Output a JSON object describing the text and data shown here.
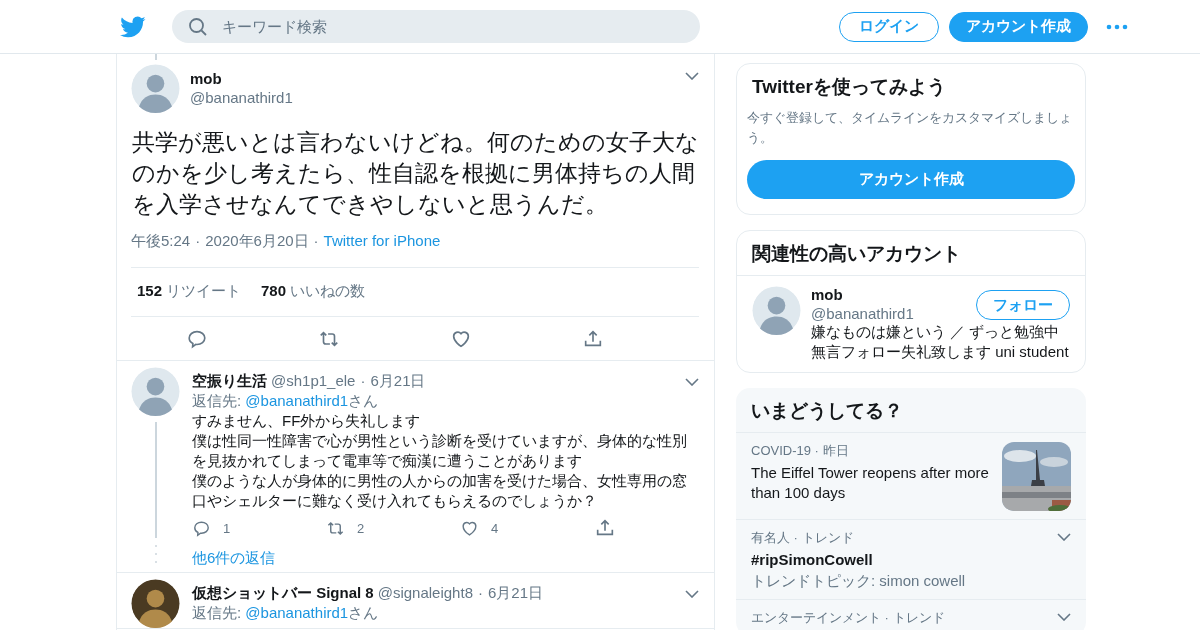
{
  "header": {
    "search_placeholder": "キーワード検索",
    "login": "ログイン",
    "signup": "アカウント作成"
  },
  "main_tweet": {
    "name": "mob",
    "handle": "@bananathird1",
    "text": "共学が悪いとは言わないけどね。何のための女子大なのかを少し考えたら、性自認を根拠に男体持ちの人間を入学させなんてできやしないと思うんだ。",
    "sep": "·",
    "time": "午後5:24",
    "date": "2020年6月20日",
    "source": "Twitter for iPhone",
    "stats": [
      {
        "count": "152",
        "label": "リツイート"
      },
      {
        "count": "780",
        "label": "いいねの数"
      }
    ]
  },
  "replies": [
    {
      "name": "空振り生活",
      "handle": "@sh1p1_ele",
      "sep": "·",
      "date": "6月21日",
      "reply_prefix": "返信先: ",
      "reply_to": "@bananathird1",
      "reply_suffix": "さん",
      "threaded": true,
      "paragraphs": [
        "すみません、FF外から失礼します",
        "僕は性同一性障害で心が男性という診断を受けていますが、身体的な性別を見抜かれてしまって電車等で痴漢に遭うことがあります",
        "僕のような人が身体的に男性の人からの加害を受けた場合、女性専用の窓口やシェルターに難なく受け入れてもらえるのでしょうか？"
      ],
      "counts": {
        "reply": "1",
        "retweet": "2",
        "like": "4"
      },
      "more": "他6件の返信"
    },
    {
      "name": "仮想ショットバー Signal 8",
      "handle": "@signaleight8",
      "sep": "·",
      "date": "6月21日",
      "reply_prefix": "返信先: ",
      "reply_to": "@bananathird1",
      "reply_suffix": "さん",
      "threaded": false
    }
  ],
  "signup_card": {
    "title": "Twitterを使ってみよう",
    "text": "今すぐ登録して、タイムラインをカスタマイズしましょう。",
    "button": "アカウント作成"
  },
  "related": {
    "title": "関連性の高いアカウント",
    "accounts": [
      {
        "name": "mob",
        "handle": "@bananathird1",
        "follow": "フォロー",
        "bio": [
          "嫌なものは嫌という ／ ずっと勉強中",
          "無言フォロー失礼致します uni student"
        ]
      }
    ]
  },
  "trends": {
    "title": "いまどうしてる？",
    "items": [
      {
        "kind": "news",
        "meta": "COVID-19 · 昨日",
        "title": "The Eiffel Tower reopens after more than 100 days"
      },
      {
        "kind": "trend",
        "meta": "有名人 · トレンド",
        "title": "#ripSimonCowell",
        "subtitle": "トレンドトピック: simon cowell"
      },
      {
        "kind": "trend",
        "meta": "エンターテインメント · トレンド"
      }
    ]
  }
}
